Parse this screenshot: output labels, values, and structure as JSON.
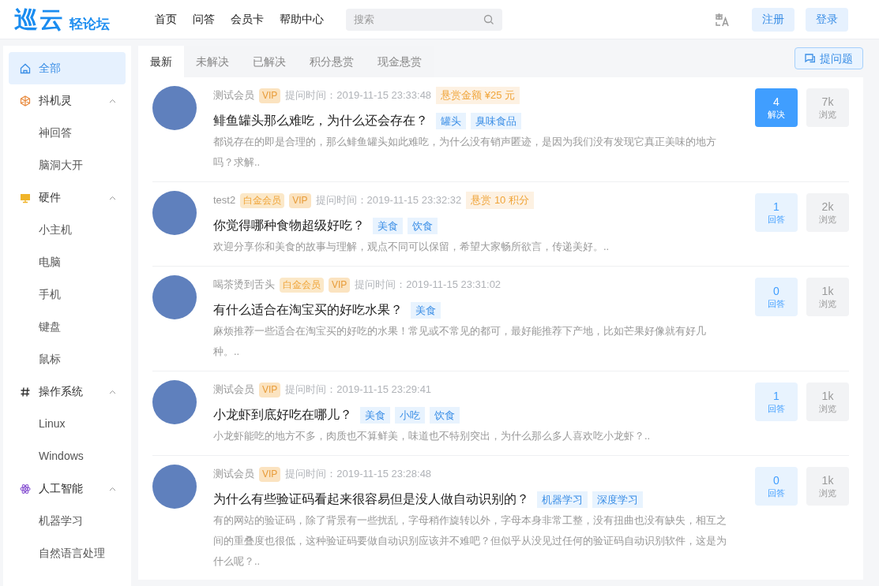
{
  "header": {
    "logo_main": "巡云",
    "logo_sub": "轻论坛",
    "nav": [
      {
        "label": "首页"
      },
      {
        "label": "问答"
      },
      {
        "label": "会员卡"
      },
      {
        "label": "帮助中心"
      }
    ],
    "search": {
      "placeholder": "搜索"
    },
    "buttons": [
      {
        "label": "注册"
      },
      {
        "label": "登录"
      }
    ]
  },
  "sidebar": {
    "items": [
      {
        "kind": "home",
        "label": "全部",
        "selected": true
      },
      {
        "kind": "group",
        "label": "抖机灵",
        "expanded": true,
        "selected": false,
        "children": [
          {
            "label": "神回答",
            "selected": false
          },
          {
            "label": "脑洞大开",
            "selected": false
          }
        ]
      },
      {
        "kind": "group",
        "label": "硬件",
        "expanded": true,
        "selected": false,
        "children": [
          {
            "label": "小主机",
            "selected": false
          },
          {
            "label": "电脑",
            "selected": false
          },
          {
            "label": "手机",
            "selected": false
          },
          {
            "label": "键盘",
            "selected": false
          },
          {
            "label": "鼠标",
            "selected": false
          }
        ]
      },
      {
        "kind": "group",
        "label": "操作系统",
        "expanded": true,
        "selected": false,
        "children": [
          {
            "label": "Linux",
            "selected": false
          },
          {
            "label": "Windows",
            "selected": false
          }
        ]
      },
      {
        "kind": "group",
        "label": "人工智能",
        "expanded": true,
        "selected": false,
        "children": [
          {
            "label": "机器学习",
            "selected": false
          },
          {
            "label": "自然语言处理",
            "selected": false
          }
        ]
      }
    ]
  },
  "tabs": [
    {
      "label": "最新",
      "selected": true
    },
    {
      "label": "未解决",
      "selected": false
    },
    {
      "label": "已解决",
      "selected": false
    },
    {
      "label": "积分悬赏",
      "selected": false
    },
    {
      "label": "现金悬赏",
      "selected": false
    }
  ],
  "ask_button": {
    "label": "提问题"
  },
  "questions": [
    {
      "user": "测试会员",
      "badges": [
        {
          "kind": "vip",
          "label": "VIP"
        }
      ],
      "time": "提问时间：2019-11-15 23:33:48",
      "reward": "悬赏金额 ¥25 元",
      "title": "鲱鱼罐头那么难吃，为什么还会存在？",
      "tags": [
        "罐头",
        "臭味食品"
      ],
      "summary": "都说存在的即是合理的，那么鲱鱼罐头如此难吃，为什么没有销声匿迹，是因为我们没有发现它真正美味的地方吗？求解..",
      "answers": "4",
      "answers_label": "解决",
      "solved": true,
      "views": "7k",
      "views_label": "浏览"
    },
    {
      "user": "test2",
      "badges": [
        {
          "kind": "platinum",
          "label": "白金会员"
        },
        {
          "kind": "vip",
          "label": "VIP"
        }
      ],
      "time": "提问时间：2019-11-15 23:32:32",
      "reward": "悬赏 10 积分",
      "title": "你觉得哪种食物超级好吃？",
      "tags": [
        "美食",
        "饮食"
      ],
      "summary": "欢迎分享你和美食的故事与理解，观点不同可以保留，希望大家畅所欲言，传递美好。..",
      "answers": "1",
      "answers_label": "回答",
      "solved": false,
      "views": "2k",
      "views_label": "浏览"
    },
    {
      "user": "喝茶烫到舌头",
      "badges": [
        {
          "kind": "platinum",
          "label": "白金会员"
        },
        {
          "kind": "vip",
          "label": "VIP"
        }
      ],
      "time": "提问时间：2019-11-15 23:31:02",
      "title": "有什么适合在淘宝买的好吃水果？",
      "tags": [
        "美食"
      ],
      "summary": "麻烦推荐一些适合在淘宝买的好吃的水果！常见或不常见的都可，最好能推荐下产地，比如芒果好像就有好几种。..",
      "answers": "0",
      "answers_label": "回答",
      "solved": false,
      "views": "1k",
      "views_label": "浏览"
    },
    {
      "user": "测试会员",
      "badges": [
        {
          "kind": "vip",
          "label": "VIP"
        }
      ],
      "time": "提问时间：2019-11-15 23:29:41",
      "title": "小龙虾到底好吃在哪儿？",
      "tags": [
        "美食",
        "小吃",
        "饮食"
      ],
      "summary": "小龙虾能吃的地方不多，肉质也不算鲜美，味道也不特别突出，为什么那么多人喜欢吃小龙虾？..",
      "answers": "1",
      "answers_label": "回答",
      "solved": false,
      "views": "1k",
      "views_label": "浏览"
    },
    {
      "user": "测试会员",
      "badges": [
        {
          "kind": "vip",
          "label": "VIP"
        }
      ],
      "time": "提问时间：2019-11-15 23:28:48",
      "title": "为什么有些验证码看起来很容易但是没人做自动识别的？",
      "tags": [
        "机器学习",
        "深度学习"
      ],
      "summary": "有的网站的验证码，除了背景有一些扰乱，字母稍作旋转以外，字母本身非常工整，没有扭曲也没有缺失，相互之间的重叠度也很低，这种验证码要做自动识别应该并不难吧？但似乎从没见过任何的验证码自动识别软件，这是为什么呢？..",
      "answers": "0",
      "answers_label": "回答",
      "solved": false,
      "views": "1k",
      "views_label": "浏览"
    }
  ]
}
